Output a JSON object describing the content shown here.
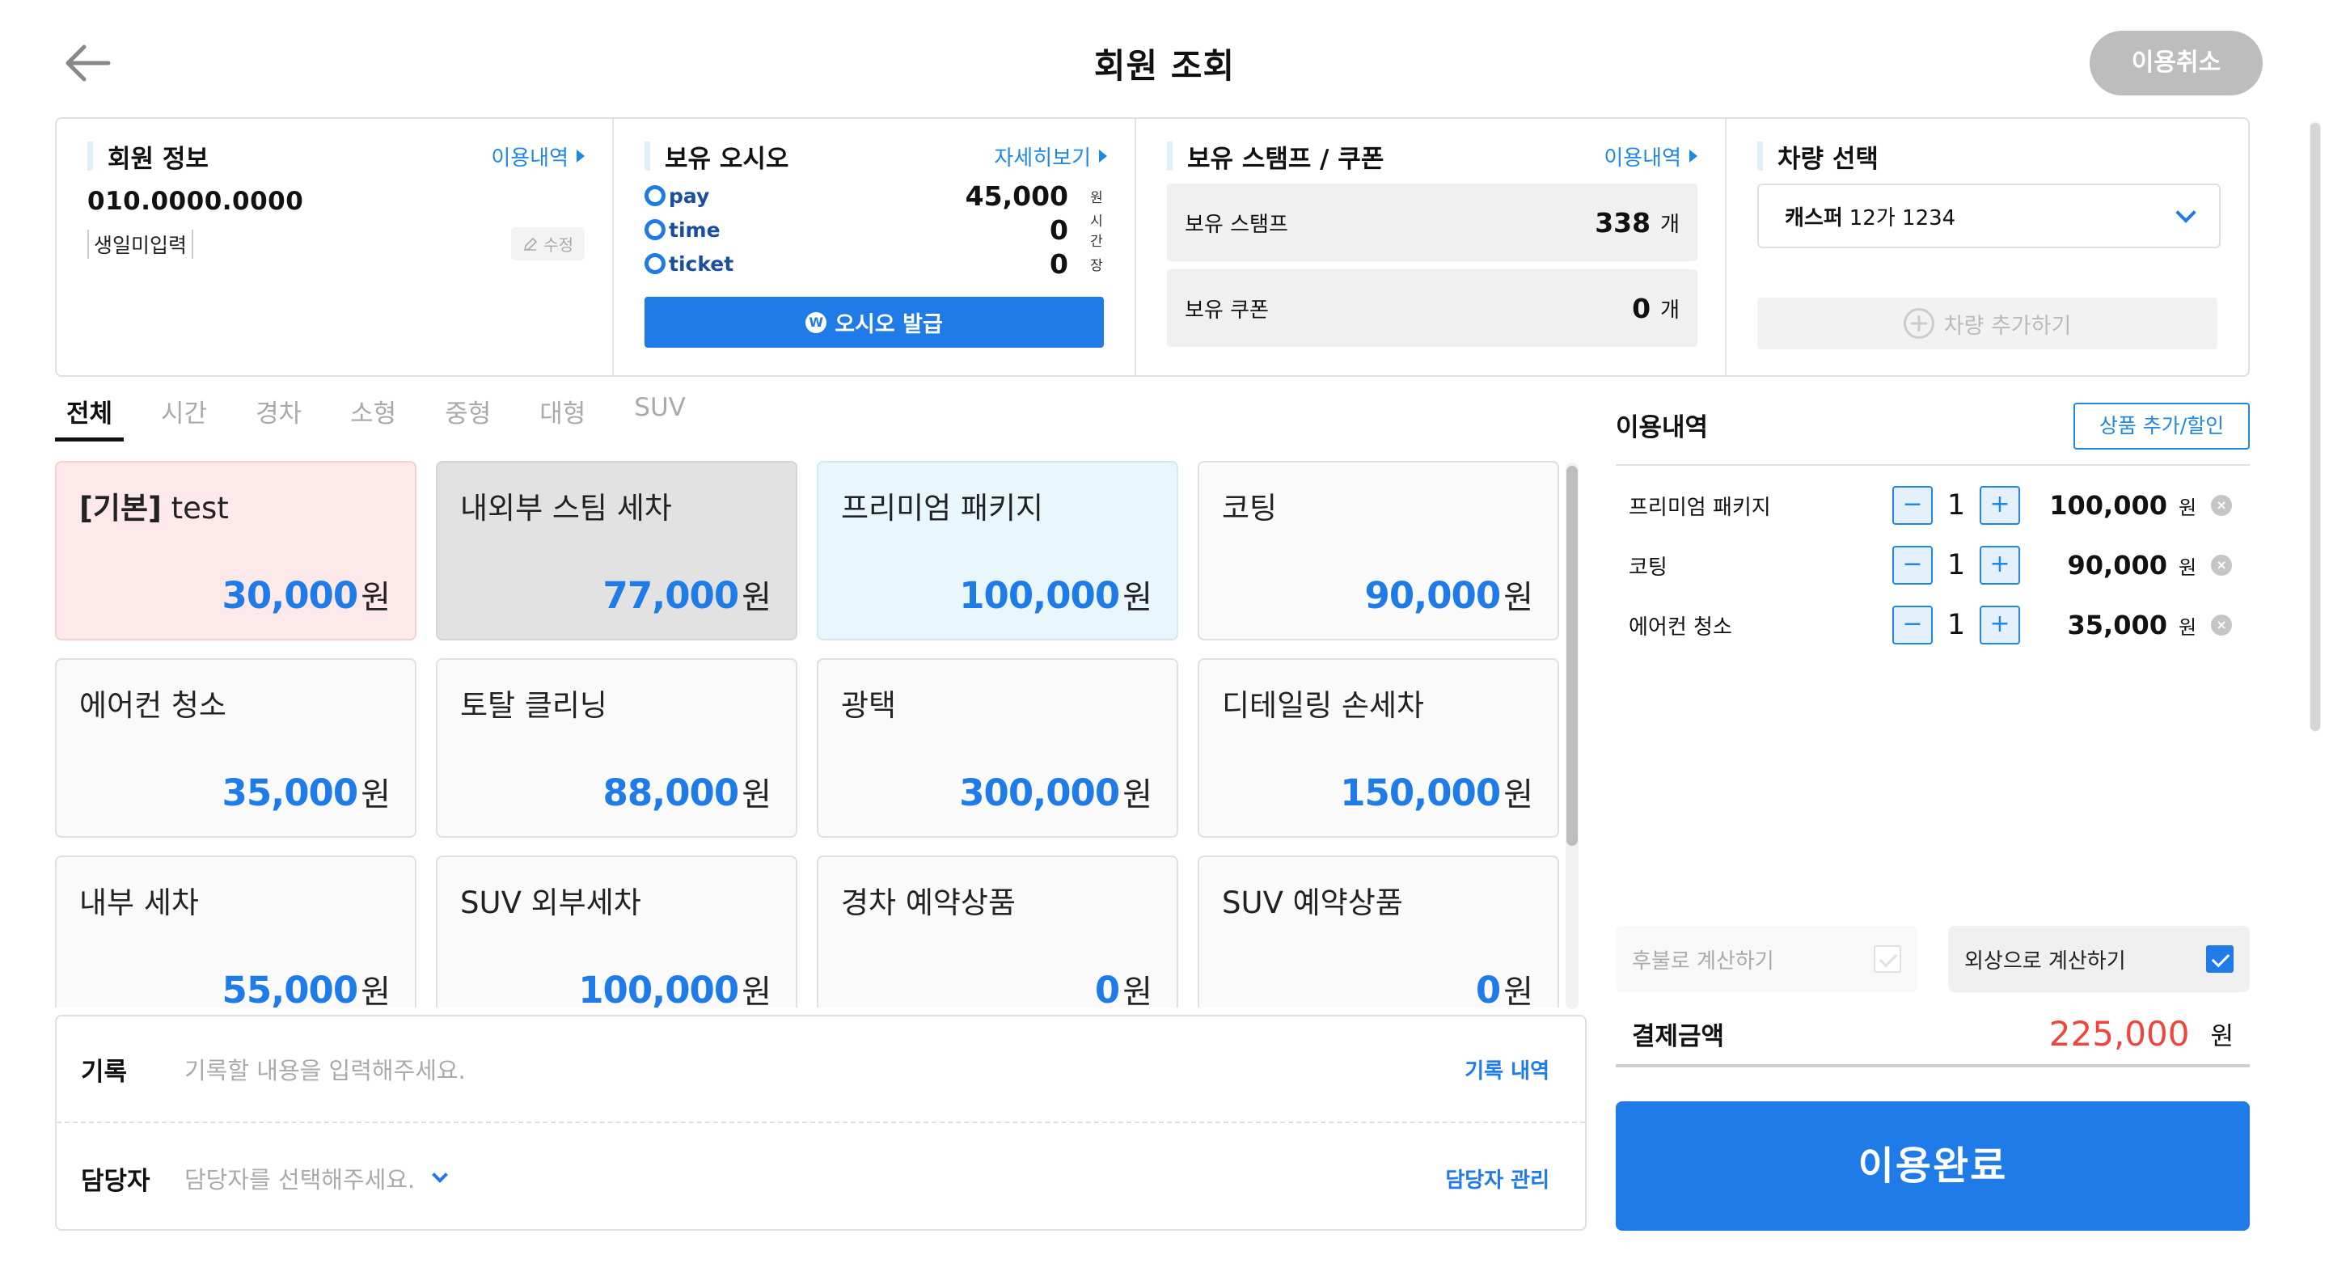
{
  "header": {
    "title": "회원 조회",
    "cancel_label": "이용취소"
  },
  "member": {
    "title": "회원 정보",
    "link": "이용내역",
    "phone": "010.0000.0000",
    "birthday": "생일미입력",
    "edit_label": "수정"
  },
  "osio": {
    "title": "보유 오시오",
    "link": "자세히보기",
    "rows": [
      {
        "name": "pay",
        "value": "45,000",
        "unit": "원"
      },
      {
        "name": "time",
        "value": "0",
        "unit": "시간"
      },
      {
        "name": "ticket",
        "value": "0",
        "unit": "장"
      }
    ],
    "issue_label": "오시오 발급",
    "issue_icon_text": "W"
  },
  "stamp": {
    "title": "보유 스탬프 / 쿠폰",
    "link": "이용내역",
    "stamp_label": "보유 스탬프",
    "stamp_value": "338",
    "stamp_unit": "개",
    "coupon_label": "보유 쿠폰",
    "coupon_value": "0",
    "coupon_unit": "개"
  },
  "vehicle": {
    "title": "차량 선택",
    "car_name": "캐스퍼",
    "car_plate": "12가 1234",
    "add_label": "차량 추가하기"
  },
  "tabs": [
    "전체",
    "시간",
    "경차",
    "소형",
    "중형",
    "대형",
    "SUV"
  ],
  "products": [
    {
      "prefix": "[기본]",
      "name": "test",
      "price": "30,000",
      "won": "원",
      "style": "pink"
    },
    {
      "prefix": "",
      "name": "내외부 스팀 세차",
      "price": "77,000",
      "won": "원",
      "style": "gray"
    },
    {
      "prefix": "",
      "name": "프리미엄 패키지",
      "price": "100,000",
      "won": "원",
      "style": "cyan"
    },
    {
      "prefix": "",
      "name": "코팅",
      "price": "90,000",
      "won": "원",
      "style": ""
    },
    {
      "prefix": "",
      "name": "에어컨 청소",
      "price": "35,000",
      "won": "원",
      "style": ""
    },
    {
      "prefix": "",
      "name": "토탈 클리닝",
      "price": "88,000",
      "won": "원",
      "style": ""
    },
    {
      "prefix": "",
      "name": "광택",
      "price": "300,000",
      "won": "원",
      "style": ""
    },
    {
      "prefix": "",
      "name": "디테일링 손세차",
      "price": "150,000",
      "won": "원",
      "style": ""
    },
    {
      "prefix": "",
      "name": "내부 세차",
      "price": "55,000",
      "won": "원",
      "style": ""
    },
    {
      "prefix": "",
      "name": "SUV 외부세차",
      "price": "100,000",
      "won": "원",
      "style": ""
    },
    {
      "prefix": "",
      "name": "경차 예약상품",
      "price": "0",
      "won": "원",
      "style": ""
    },
    {
      "prefix": "",
      "name": "SUV 예약상품",
      "price": "0",
      "won": "원",
      "style": ""
    }
  ],
  "memo": {
    "record_label": "기록",
    "record_placeholder": "기록할 내용을 입력해주세요.",
    "record_link": "기록 내역",
    "staff_label": "담당자",
    "staff_placeholder": "담당자를 선택해주세요.",
    "staff_link": "담당자 관리"
  },
  "usage": {
    "title": "이용내역",
    "add_discount_label": "상품 추가/할인",
    "items": [
      {
        "name": "프리미엄 패키지",
        "qty": "1",
        "price": "100,000",
        "won": "원"
      },
      {
        "name": "코팅",
        "qty": "1",
        "price": "90,000",
        "won": "원"
      },
      {
        "name": "에어컨 청소",
        "qty": "1",
        "price": "35,000",
        "won": "원"
      }
    ],
    "minus": "−",
    "plus": "+",
    "delete_glyph": "×",
    "deferred_label": "후불로 계산하기",
    "deferred_checked": false,
    "credit_label": "외상으로 계산하기",
    "credit_checked": true,
    "total_label": "결제금액",
    "total_value": "225,000",
    "total_won": "원",
    "complete_label": "이용완료"
  },
  "colors": {
    "accent": "#1e7be8",
    "total": "#f0453a"
  }
}
